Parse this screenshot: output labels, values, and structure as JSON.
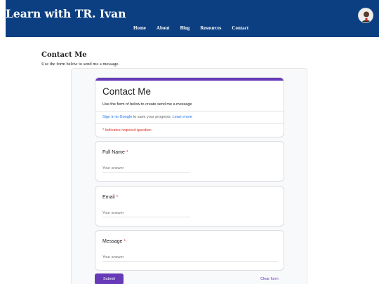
{
  "header": {
    "site_title": "Learn with TR. Ivan",
    "nav": [
      "Home",
      "About",
      "Blog",
      "Resources",
      "Contact"
    ]
  },
  "page": {
    "heading": "Contact Me",
    "subtitle": "Use the form below to send me a message."
  },
  "form": {
    "title": "Contact Me",
    "description": "Use the form of below to create send me a message",
    "sign_in_link": "Sign in to Google",
    "sign_in_text": " to save your progress. ",
    "learn_more": "Learn more",
    "required_note": "* Indicates required question",
    "questions": [
      {
        "label": "Full Name",
        "required_mark": "*",
        "placeholder": "Your answer"
      },
      {
        "label": "Email",
        "required_mark": "*",
        "placeholder": "Your answer"
      },
      {
        "label": "Message",
        "required_mark": "*",
        "placeholder": "Your answer"
      }
    ],
    "submit_label": "Submit",
    "clear_label": "Clear form"
  },
  "colors": {
    "header_bg": "#0b3f82",
    "form_accent": "#673ab7",
    "required": "#d93025",
    "link": "#1a73e8"
  }
}
